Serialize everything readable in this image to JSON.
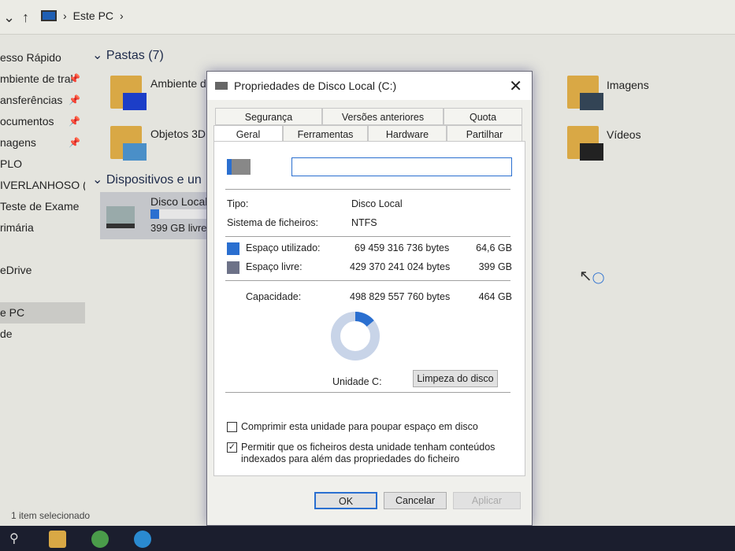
{
  "explorer": {
    "breadcrumb": "Este PC",
    "sidebar": [
      {
        "label": "esso Rápido",
        "pinned": false
      },
      {
        "label": "mbiente de tral",
        "pinned": true
      },
      {
        "label": "ansferências",
        "pinned": true
      },
      {
        "label": "ocumentos",
        "pinned": true
      },
      {
        "label": "nagens",
        "pinned": true
      },
      {
        "label": "PLO",
        "pinned": false
      },
      {
        "label": "IVERLANHOSO (ca",
        "pinned": false
      },
      {
        "label": " Teste de Exame",
        "pinned": false
      },
      {
        "label": "rimária",
        "pinned": false
      },
      {
        "label": "",
        "pinned": false
      },
      {
        "label": "eDrive",
        "pinned": false
      },
      {
        "label": "",
        "pinned": false
      },
      {
        "label": "e PC",
        "pinned": false
      },
      {
        "label": "de",
        "pinned": false
      }
    ],
    "folders_header": "Pastas (7)",
    "folders": [
      "Ambiente d",
      "Objetos 3D",
      "Imagens",
      "Vídeos"
    ],
    "devices_header": "Dispositivos e un",
    "drive": {
      "name": "Disco Local",
      "free": "399 GB livre",
      "used_fraction": 0.14
    },
    "status": "1 item selecionado"
  },
  "dialog": {
    "title": "Propriedades de Disco Local (C:)",
    "tabs_row1": [
      "Segurança",
      "Versões anteriores",
      "Quota"
    ],
    "tabs_row2": [
      "Geral",
      "Ferramentas",
      "Hardware",
      "Partilhar"
    ],
    "name_value": "",
    "type_label": "Tipo:",
    "type_value": "Disco Local",
    "fs_label": "Sistema de ficheiros:",
    "fs_value": "NTFS",
    "used_label": "Espaço utilizado:",
    "used_bytes": "69 459 316 736 bytes",
    "used_gb": "64,6 GB",
    "free_label": "Espaço livre:",
    "free_bytes": "429 370 241 024 bytes",
    "free_gb": "399 GB",
    "cap_label": "Capacidade:",
    "cap_bytes": "498 829 557 760 bytes",
    "cap_gb": "464 GB",
    "used_fraction": 0.139,
    "drive_label": "Unidade C:",
    "cleanup": "Limpeza do disco",
    "compress": "Comprimir esta unidade para poupar espaço em disco",
    "index": "Permitir que os ficheiros desta unidade tenham conteúdos indexados para além das propriedades do ficheiro",
    "compress_checked": false,
    "index_checked": true,
    "ok": "OK",
    "cancel": "Cancelar",
    "apply": "Aplicar",
    "colors": {
      "used": "#2a6fd0",
      "free": "#6d7288"
    }
  }
}
